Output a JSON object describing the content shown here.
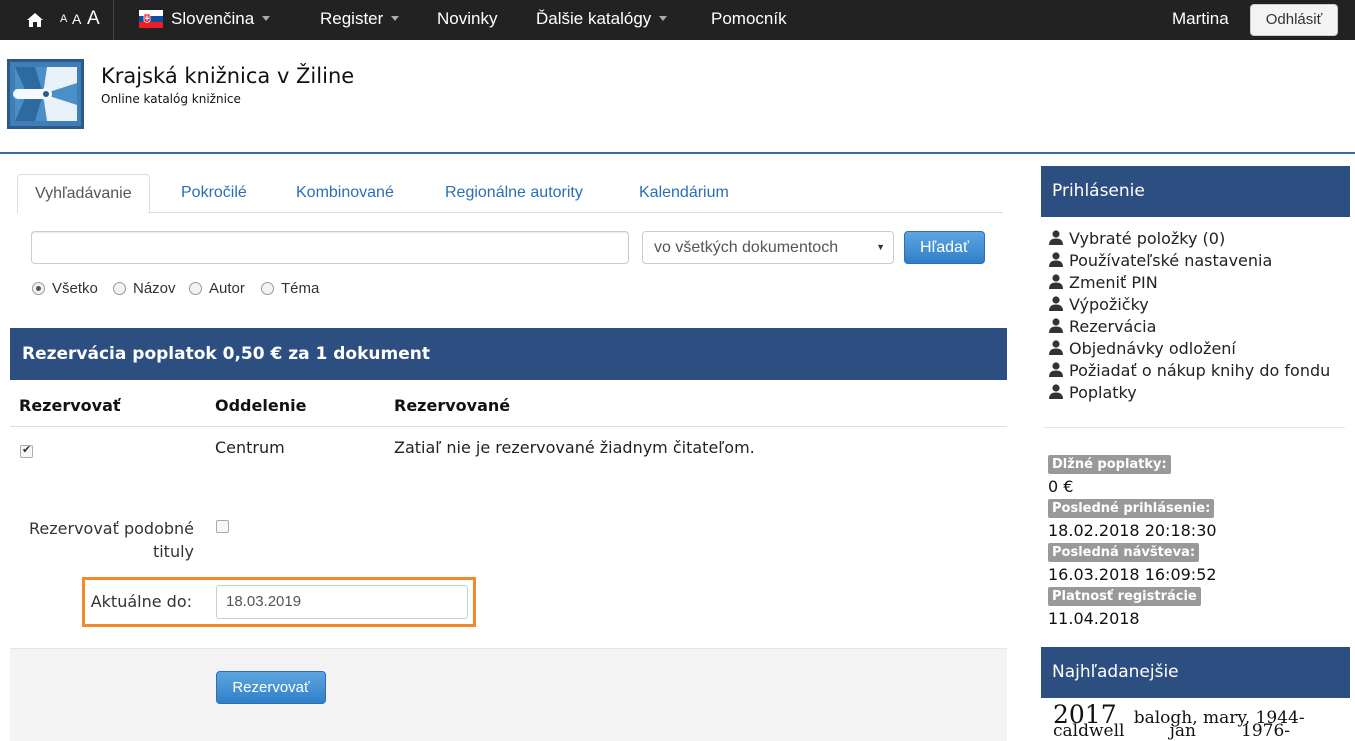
{
  "navbar": {
    "font_sizes": [
      "A",
      "A",
      "A"
    ],
    "language": "Slovenčina",
    "register": "Register",
    "news": "Novinky",
    "other_catalogs": "Ďalšie katalógy",
    "helper": "Pomocník",
    "user": "Martina",
    "logout": "Odhlásiť"
  },
  "header": {
    "title": "Krajská knižnica v Žiline",
    "subtitle": "Online katalóg knižnice"
  },
  "tabs": [
    "Vyhľadávanie",
    "Pokročilé",
    "Kombinované",
    "Regionálne autority",
    "Kalendárium"
  ],
  "search": {
    "value": "",
    "scope": "vo všetkých dokumentoch",
    "button": "Hľadať",
    "radios": [
      "Všetko",
      "Názov",
      "Autor",
      "Téma"
    ],
    "selected_radio": "Všetko"
  },
  "reservation": {
    "header": "Rezervácia poplatok 0,50 € za 1 dokument",
    "columns": [
      "Rezervovať",
      "Oddelenie",
      "Rezervované"
    ],
    "row": {
      "checked": true,
      "department": "Centrum",
      "status": "Zatiaľ nie je rezervované žiadnym čitateľom."
    },
    "similar_label_1": "Rezervovať podobné",
    "similar_label_2": "tituly",
    "valid_until_label": "Aktuálne do:",
    "valid_until_value": "18.03.2019",
    "submit": "Rezervovať"
  },
  "sidebar": {
    "login_title": "Prihlásenie",
    "links": [
      "Vybraté položky (0)",
      "Používateľské nastavenia",
      "Zmeniť PIN",
      "Výpožičky",
      "Rezervácia",
      "Objednávky odložení",
      "Požiadať o nákup knihy do fondu",
      "Poplatky"
    ],
    "info": [
      {
        "label": "Dlžné poplatky:",
        "value": "0 €"
      },
      {
        "label": "Posledné prihlásenie:",
        "value": "18.02.2018 20:18:30"
      },
      {
        "label": "Posledná návšteva:",
        "value": "16.03.2018 16:09:52"
      },
      {
        "label": "Platnosť registrácie",
        "value": "11.04.2018"
      }
    ],
    "popular_title": "Najhľadanejšie",
    "cloud": [
      "2017",
      "balogh, mary, 1944-",
      "caldwell",
      "jan",
      "1976-"
    ]
  },
  "colors": {
    "navbar_bg": "#222222",
    "panel_header": "#2d4e80",
    "link": "#2a6eb8",
    "highlight": "#f5882b",
    "primary_button": "#2f7fc8"
  }
}
